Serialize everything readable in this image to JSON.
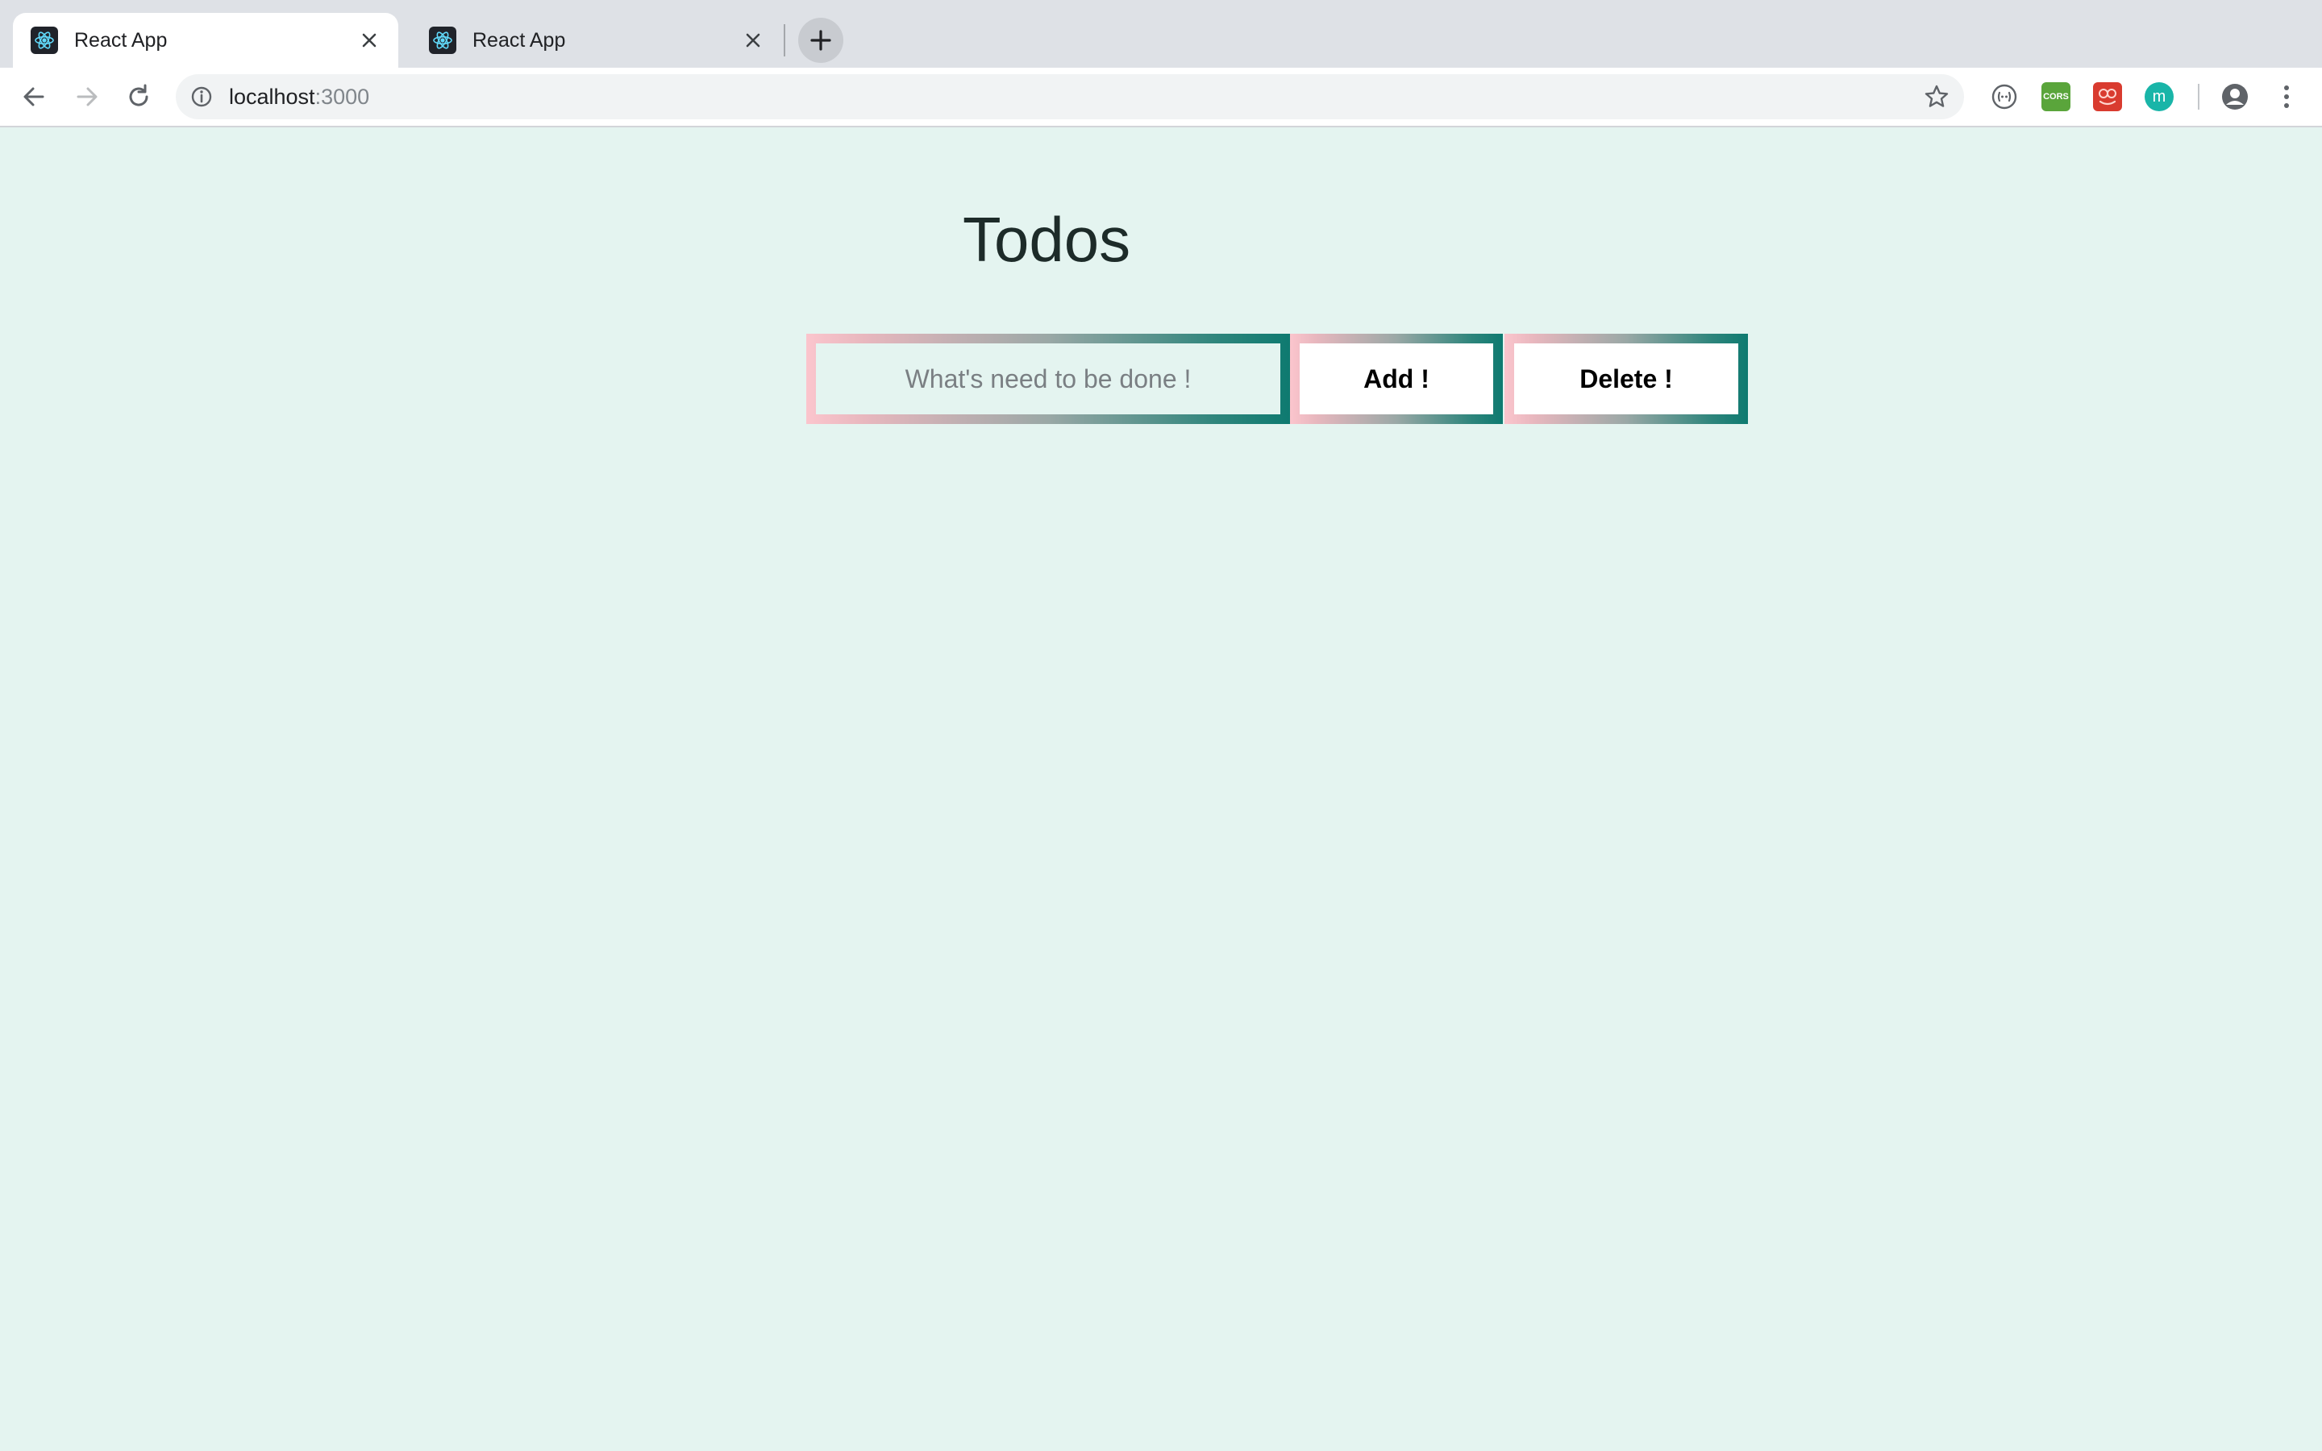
{
  "browser": {
    "tabs": [
      {
        "title": "React App",
        "active": true
      },
      {
        "title": "React App",
        "active": false
      }
    ],
    "address": {
      "host": "localhost",
      "port": ":3000"
    },
    "extensions": [
      {
        "name": "ghost-extension-icon"
      },
      {
        "name": "cors-extension-icon",
        "label": "CORS"
      },
      {
        "name": "red-extension-icon"
      },
      {
        "name": "teal-m-extension-icon",
        "label": "m"
      }
    ]
  },
  "app": {
    "title": "Todos",
    "input": {
      "placeholder": "What's need to be done !",
      "value": ""
    },
    "add_label": "Add !",
    "delete_label": "Delete !"
  },
  "colors": {
    "page_background": "#e4f4f0",
    "gradient_start": "#fbc5cd",
    "gradient_end": "#0e7a70"
  }
}
